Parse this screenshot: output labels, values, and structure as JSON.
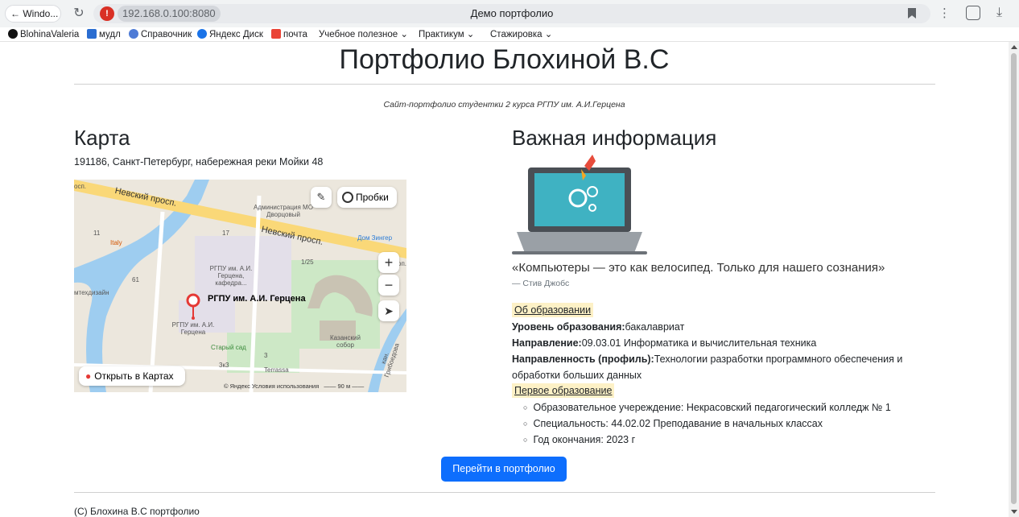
{
  "browser": {
    "window_button": "← Windo...",
    "url": "192.168.0.100:8080",
    "tab_title": "Демо портфолио",
    "bookmarks": [
      "BlohinaValeria",
      "мудл",
      "Справочник",
      "Яндекс Диск",
      "почта",
      "Учебное полезное ⌄",
      "Практикум ⌄",
      "Стажировка ⌄"
    ]
  },
  "page": {
    "title": "Портфолио Блохиной В.С",
    "subtitle": "Сайт-портфолио студентки 2 курса РГПУ им. А.И.Герцена"
  },
  "map_section": {
    "heading": "Карта",
    "address": "191186, Санкт-Петербург, набережная реки Мойки 48",
    "map": {
      "traffic_label": "Пробки",
      "open_label": "Открыть в Картах",
      "poi_title": "РГПУ им. А.И. Герцена",
      "streets": [
        "Невский просп.",
        "Невский просп."
      ],
      "labels": [
        "Администрация МО Дворцовый",
        "Дом Зингер",
        "Italy",
        "РГПУ им. А.И. Герцена, кафедра...",
        "РГПУ им. А.И. Герцена",
        "Старый сад",
        "Terrassa",
        "Казанский собор",
        "мтехдизайн",
        "кан. Грибоедова",
        "1/25",
        "17",
        "11",
        "61",
        "3",
        "3к3",
        "осп.",
        "оп."
      ],
      "footer": "© Яндекс   Условия использования",
      "scale": "90 м"
    }
  },
  "info_section": {
    "heading": "Важная информация",
    "quote": "«Компьютеры — это как велосипед. Только для нашего сознания»",
    "quote_author": "— Стив Джобс",
    "education_link": "Об образовании",
    "level_label": "Уровень образования:",
    "level_value": "бакалавриат",
    "direction_label": "Направление:",
    "direction_value": "09.03.01 Информатика и вычислительная техника",
    "profile_label": "Направленность (профиль):",
    "profile_value": "Технологии разработки программного обеспечения и обработки больших данных",
    "first_education_link": "Первое образование",
    "first_education_items": [
      "Образовательное учереждение: Некрасовский педагогический колледж № 1",
      "Специальность: 44.02.02 Преподавание в начальных классах",
      "Год окончания: 2023 г"
    ]
  },
  "cta_label": "Перейти в портфолио",
  "footer": "(С) Блохина В.С портфолио",
  "colors": {
    "primary": "#0d6efd",
    "highlight": "#fdf1c6",
    "map_pin": "#e53935"
  }
}
